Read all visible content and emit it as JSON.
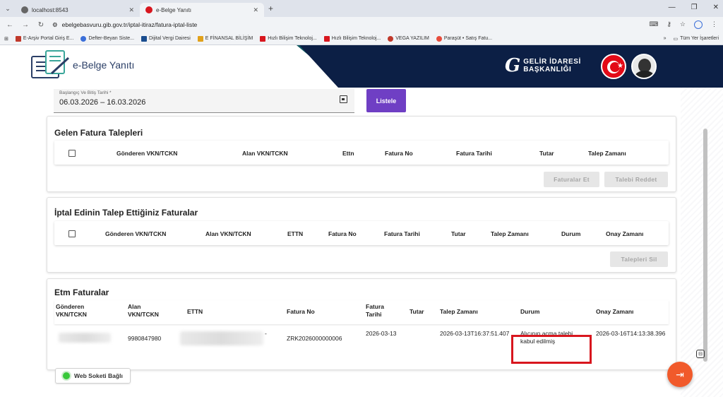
{
  "browser": {
    "tabs": [
      {
        "label": "localhost:8543",
        "active": false
      },
      {
        "label": "e-Belge Yanıtı",
        "active": true
      }
    ],
    "url": "ebelgebasvuru.gib.gov.tr/iptal-itiraz/fatura-iptal-liste",
    "bookmarks": [
      "E-Arşiv Portal Giriş E...",
      "Defter-Beyan Siste...",
      "Dijital Vergi Dairesi",
      "E FİNANSAL BİLİŞİM",
      "Hızlı Bilişim Teknoloj...",
      "Hızlı Bilişim Teknoloj...",
      "VEGA YAZILIM",
      "Paraşüt • Satış Fatu..."
    ],
    "bookmarks_more": "»",
    "all_bookmarks": "Tüm Yer İşaretleri",
    "colors": {
      "chrome": "#dfe3eb",
      "accent": "#6f3fc4",
      "navy": "#0c1f45",
      "alert": "#d8161e"
    }
  },
  "header": {
    "app_title": "e-Belge Yanıtı",
    "gib_line1": "GELİR İDARESİ",
    "gib_line2": "BAŞKANLIĞI"
  },
  "filter": {
    "date_label": "Başlangıç Ve Bitiş Tarihi *",
    "date_value": "06.03.2026 – 16.03.2026",
    "listele_label": "Listele"
  },
  "gelen": {
    "title": "Gelen Fatura Talepleri",
    "columns": [
      "Gönderen VKN/TCKN",
      "Alan VKN/TCKN",
      "Ettn",
      "Fatura No",
      "Fatura Tarihi",
      "Tutar",
      "Talep Zamanı"
    ],
    "btn_faturalar": "Faturalar Et",
    "btn_reddet": "Talebi Reddet"
  },
  "iptal": {
    "title": "İptal Edinin Talep Ettiğiniz Faturalar",
    "columns": [
      "Gönderen VKN/TCKN",
      "Alan VKN/TCKN",
      "ETTN",
      "Fatura No",
      "Fatura Tarihi",
      "Tutar",
      "Talep Zamanı",
      "Durum",
      "Onay Zamanı"
    ],
    "btn_sil": "Talepleri Sil"
  },
  "etm": {
    "title": "Etm Faturalar",
    "columns": [
      "Gönderen VKN/TCKN",
      "Alan VKN/TCKN",
      "ETTN",
      "Fatura No",
      "Fatura Tarihi",
      "Tutar",
      "Talep Zamanı",
      "Durum",
      "Onay Zamanı"
    ],
    "row": {
      "alan": "9980847980",
      "ettn_tail": "-",
      "fatura_no": "ZRK2026000000006",
      "fatura_tarihi": "2026-03-13",
      "tutar": "",
      "talep_zamani": "2026-03-13T16:37:51.407",
      "durum": "Alıcının açma talebi kabul edilmiş",
      "onay_zamani": "2026-03-16T14:13:38.396"
    }
  },
  "websocket_label": "Web Soketi Bağlı"
}
